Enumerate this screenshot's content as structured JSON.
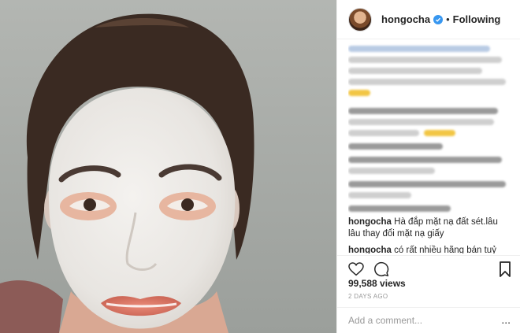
{
  "post": {
    "username": "hongocha",
    "follow_state": "Following",
    "separator": "•",
    "views": "99,588 views",
    "time_ago": "2 DAYS AGO",
    "add_comment_placeholder": "Add a comment...",
    "more_glyph": "..."
  },
  "comments": [
    {
      "username": "hongocha",
      "text": "Hà đắp mặt nạ đất sét.lâu lâu thay đổi mặt nạ giấy"
    },
    {
      "username": "hongocha",
      "text": "có rất nhiều hãng bán tuỷ vào loại da nhé"
    }
  ],
  "icons": {
    "verified": "verified-badge-icon",
    "like": "heart-icon",
    "comment": "comment-icon",
    "save": "bookmark-icon"
  },
  "colors": {
    "verified": "#3897f0",
    "muted": "#999999",
    "text": "#262626"
  }
}
